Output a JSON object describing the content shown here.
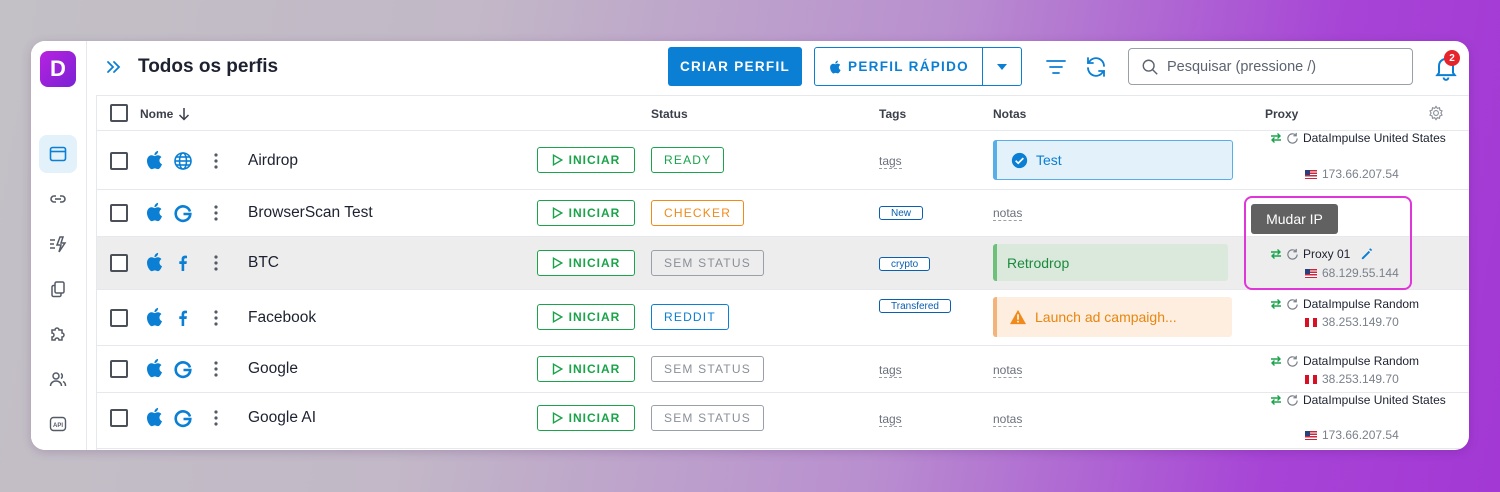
{
  "header": {
    "title": "Todos os perfis",
    "create_label": "CRIAR PERFIL",
    "quick_label": "PERFIL RÁPIDO",
    "search_placeholder": "Pesquisar (pressione /)",
    "notification_count": "2"
  },
  "sidebar": {
    "logo": "D",
    "items": [
      {
        "icon": "browser-window-icon",
        "active": true
      },
      {
        "icon": "link-icon",
        "active": false
      },
      {
        "icon": "automation-icon",
        "active": false
      },
      {
        "icon": "clone-icon",
        "active": false
      },
      {
        "icon": "extension-puzzle-icon",
        "active": false
      },
      {
        "icon": "users-icon",
        "active": false
      },
      {
        "icon": "api-icon",
        "label": "API",
        "active": false
      }
    ]
  },
  "table": {
    "columns": {
      "name": "Nome",
      "status": "Status",
      "tags": "Tags",
      "notes": "Notas",
      "proxy": "Proxy"
    },
    "start_label": "INICIAR",
    "rows": [
      {
        "name": "Airdrop",
        "os_icon": "apple-icon",
        "browser_icon": "globe-icon",
        "status": "READY",
        "status_color": "#1aa34a",
        "tag": "tags",
        "tag_is_pill": false,
        "note": "Test",
        "note_style": "blue",
        "proxy_name": "DataImpulse United States",
        "proxy_ip": "173.66.207.54",
        "flag": "us"
      },
      {
        "name": "BrowserScan Test",
        "os_icon": "apple-icon",
        "browser_icon": "google-icon",
        "status": "CHECKER",
        "status_color": "#f08a1a",
        "tag": "New",
        "tag_is_pill": true,
        "note": "notas",
        "note_style": "plain",
        "proxy_name": "",
        "proxy_ip": "",
        "flag": ""
      },
      {
        "name": "BTC",
        "os_icon": "apple-icon",
        "browser_icon": "facebook-icon",
        "status": "SEM STATUS",
        "status_color": "#8a8f98",
        "tag": "crypto",
        "tag_is_pill": true,
        "note": "Retrodrop",
        "note_style": "green",
        "proxy_name": "Proxy 01",
        "proxy_ip": "68.129.55.144",
        "flag": "us"
      },
      {
        "name": "Facebook",
        "os_icon": "apple-icon",
        "browser_icon": "facebook-icon",
        "status": "REDDIT",
        "status_color": "#0a7fd4",
        "tag": "Transfered",
        "tag_is_pill": true,
        "note": "Launch ad campaigh...",
        "note_style": "orange",
        "proxy_name": "DataImpulse Random",
        "proxy_ip": "38.253.149.70",
        "flag": "pe"
      },
      {
        "name": "Google",
        "os_icon": "apple-icon",
        "browser_icon": "google-icon",
        "status": "SEM STATUS",
        "status_color": "#8a8f98",
        "tag": "tags",
        "tag_is_pill": false,
        "note": "notas",
        "note_style": "plain",
        "proxy_name": "DataImpulse Random",
        "proxy_ip": "38.253.149.70",
        "flag": "pe"
      },
      {
        "name": "Google AI",
        "os_icon": "apple-icon",
        "browser_icon": "google-icon",
        "status": "SEM STATUS",
        "status_color": "#8a8f98",
        "tag": "tags",
        "tag_is_pill": false,
        "note": "notas",
        "note_style": "plain",
        "proxy_name": "DataImpulse United States",
        "proxy_ip": "173.66.207.54",
        "flag": "us"
      }
    ]
  },
  "tooltip": {
    "label": "Mudar IP"
  },
  "colors": {
    "accent": "#0a7fd4",
    "green": "#1aa34a",
    "orange": "#f08a1a",
    "highlight_frame": "#e035d9"
  }
}
